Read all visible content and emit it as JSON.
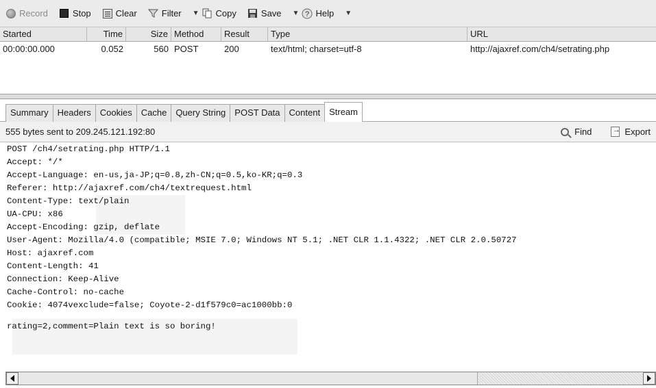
{
  "toolbar": {
    "record": "Record",
    "stop": "Stop",
    "clear": "Clear",
    "filter": "Filter",
    "copy": "Copy",
    "save": "Save",
    "help": "Help",
    "icons": [
      "record-icon",
      "stop-icon",
      "clear-icon",
      "filter-icon",
      "copy-icon",
      "save-icon",
      "help-icon",
      "dropdown-arrow-icon"
    ]
  },
  "grid": {
    "headers": [
      "Started",
      "Time",
      "Size",
      "Method",
      "Result",
      "Type",
      "URL"
    ],
    "rows": [
      [
        "00:00:00.000",
        "0.052",
        "560",
        "POST",
        "200",
        "text/html; charset=utf-8",
        "http://ajaxref.com/ch4/setrating.php"
      ]
    ]
  },
  "tabs": [
    "Summary",
    "Headers",
    "Cookies",
    "Cache",
    "Query String",
    "POST Data",
    "Content",
    "Stream"
  ],
  "active_tab": "Stream",
  "info": {
    "text": "555 bytes sent to 209.245.121.192:80",
    "find": "Find",
    "export": "Export"
  },
  "stream": {
    "headers": [
      "POST /ch4/setrating.php HTTP/1.1",
      "Accept: */*",
      "Accept-Language: en-us,ja-JP;q=0.8,zh-CN;q=0.5,ko-KR;q=0.3",
      "Referer: http://ajaxref.com/ch4/textrequest.html",
      "Content-Type: text/plain",
      "UA-CPU: x86",
      "Accept-Encoding: gzip, deflate",
      "User-Agent: Mozilla/4.0 (compatible; MSIE 7.0; Windows NT 5.1; .NET CLR 1.1.4322; .NET CLR 2.0.50727",
      "Host: ajaxref.com",
      "Content-Length: 41",
      "Connection: Keep-Alive",
      "Cache-Control: no-cache",
      "Cookie: 4074vexclude=false; Coyote-2-d1f579c0=ac1000bb:0"
    ],
    "body": "rating=2,comment=Plain text is so boring!"
  }
}
